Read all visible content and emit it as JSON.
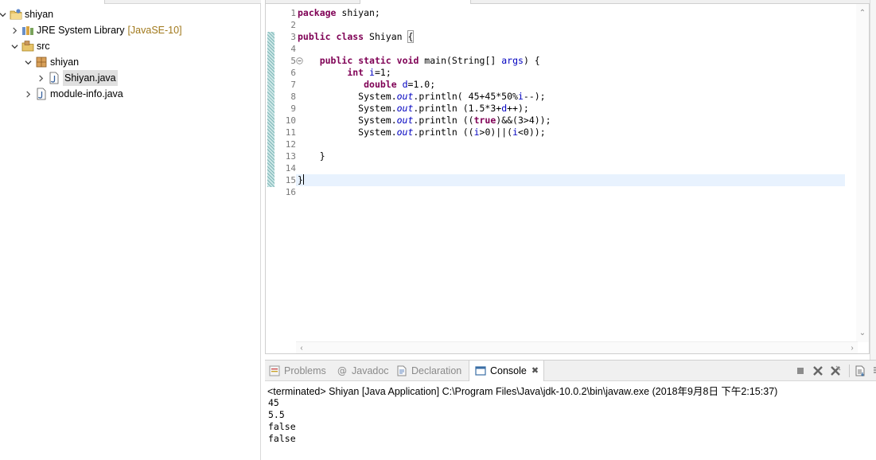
{
  "explorer": {
    "tree": [
      {
        "label": "shiyan",
        "decoration": ""
      },
      {
        "label": "JRE System Library",
        "decoration": "[JavaSE-10]"
      },
      {
        "label": "src",
        "decoration": ""
      },
      {
        "label": "shiyan",
        "decoration": ""
      },
      {
        "label": "Shiyan.java",
        "decoration": ""
      },
      {
        "label": "module-info.java",
        "decoration": ""
      }
    ]
  },
  "editor": {
    "line_numbers": [
      "1",
      "2",
      "3",
      "4",
      "5",
      "6",
      "7",
      "8",
      "9",
      "10",
      "11",
      "12",
      "13",
      "14",
      "15",
      "16"
    ],
    "current_line": 15,
    "lines": [
      [
        {
          "t": "package",
          "c": "kw"
        },
        {
          "t": " shiyan;",
          "c": ""
        }
      ],
      [],
      [
        {
          "t": "public",
          "c": "kw"
        },
        {
          "t": " ",
          "c": ""
        },
        {
          "t": "class",
          "c": "kw"
        },
        {
          "t": " Shiyan ",
          "c": ""
        },
        {
          "t": "{",
          "c": "bm"
        }
      ],
      [],
      [
        {
          "t": "    ",
          "c": ""
        },
        {
          "t": "public",
          "c": "kw"
        },
        {
          "t": " ",
          "c": ""
        },
        {
          "t": "static",
          "c": "kw"
        },
        {
          "t": " ",
          "c": ""
        },
        {
          "t": "void",
          "c": "kw"
        },
        {
          "t": " main(String[] ",
          "c": ""
        },
        {
          "t": "args",
          "c": "pv"
        },
        {
          "t": ") {",
          "c": ""
        }
      ],
      [
        {
          "t": "         ",
          "c": ""
        },
        {
          "t": "int",
          "c": "kw"
        },
        {
          "t": " ",
          "c": ""
        },
        {
          "t": "i",
          "c": "pv"
        },
        {
          "t": "=1;",
          "c": ""
        }
      ],
      [
        {
          "t": "            ",
          "c": ""
        },
        {
          "t": "double",
          "c": "kw"
        },
        {
          "t": " ",
          "c": ""
        },
        {
          "t": "d",
          "c": "pv"
        },
        {
          "t": "=1.0;",
          "c": ""
        }
      ],
      [
        {
          "t": "           System.",
          "c": ""
        },
        {
          "t": "out",
          "c": "st"
        },
        {
          "t": ".println( 45+45*50%",
          "c": ""
        },
        {
          "t": "i",
          "c": "pv"
        },
        {
          "t": "--);",
          "c": ""
        }
      ],
      [
        {
          "t": "           System.",
          "c": ""
        },
        {
          "t": "out",
          "c": "st"
        },
        {
          "t": ".println (1.5*3+",
          "c": ""
        },
        {
          "t": "d",
          "c": "pv"
        },
        {
          "t": "++);",
          "c": ""
        }
      ],
      [
        {
          "t": "           System.",
          "c": ""
        },
        {
          "t": "out",
          "c": "st"
        },
        {
          "t": ".println ((",
          "c": ""
        },
        {
          "t": "true",
          "c": "kw"
        },
        {
          "t": ")&&(3>4));",
          "c": ""
        }
      ],
      [
        {
          "t": "           System.",
          "c": ""
        },
        {
          "t": "out",
          "c": "st"
        },
        {
          "t": ".println ((",
          "c": ""
        },
        {
          "t": "i",
          "c": "pv"
        },
        {
          "t": ">0)||(",
          "c": ""
        },
        {
          "t": "i",
          "c": "pv"
        },
        {
          "t": "<0));",
          "c": ""
        }
      ],
      [],
      [
        {
          "t": "    }",
          "c": ""
        }
      ],
      [],
      [
        {
          "t": "}",
          "c": ""
        }
      ],
      []
    ]
  },
  "views": {
    "tabs": [
      {
        "label": "Problems",
        "icon": "problems-icon"
      },
      {
        "label": "Javadoc",
        "icon": "javadoc-icon"
      },
      {
        "label": "Declaration",
        "icon": "declaration-icon"
      },
      {
        "label": "Console",
        "icon": "console-icon"
      }
    ],
    "active_tab": "Console",
    "console": {
      "description": "<terminated> Shiyan [Java Application] C:\\Program Files\\Java\\jdk-10.0.2\\bin\\javaw.exe (2018年9月8日 下午2:15:37)",
      "output": [
        "45",
        "5.5",
        "false",
        "false"
      ]
    }
  },
  "colors": {
    "keyword": "#7f0055",
    "variable": "#0000c0",
    "current_line": "#e8f2fe",
    "library_decoration": "#a0781a"
  }
}
